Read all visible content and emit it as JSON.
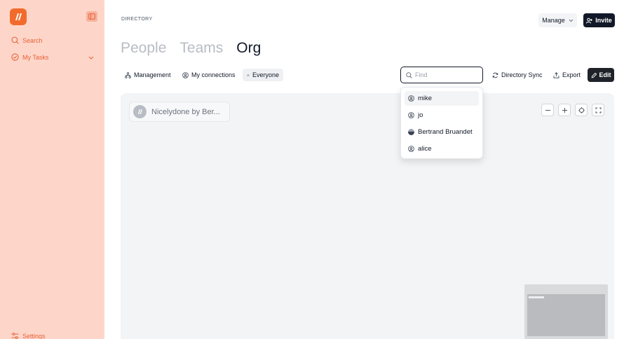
{
  "sidebar": {
    "items": [
      {
        "label": "Search",
        "icon": "search-icon"
      },
      {
        "label": "My Tasks",
        "icon": "check-circle-icon"
      }
    ],
    "settings_label": "Settings",
    "accent": "#f26b2c",
    "background": "#fdd6c9"
  },
  "header": {
    "breadcrumb": "DIRECTORY",
    "manage_label": "Manage",
    "invite_label": "Invite"
  },
  "tabs": [
    {
      "label": "People",
      "active": false
    },
    {
      "label": "Teams",
      "active": false
    },
    {
      "label": "Org",
      "active": true
    }
  ],
  "filters": [
    {
      "label": "Management",
      "icon": "hierarchy-icon"
    },
    {
      "label": "My connections",
      "icon": "person-circle-icon"
    },
    {
      "label": "Everyone",
      "icon": "group-icon",
      "selected": true
    }
  ],
  "find": {
    "placeholder": "Find",
    "value": ""
  },
  "actions": {
    "directory_sync_label": "Directory Sync",
    "export_label": "Export",
    "edit_label": "Edit"
  },
  "org_chart": {
    "root_node_name": "Nicelydone by Ber..."
  },
  "dropdown": {
    "items": [
      {
        "label": "mike",
        "highlighted": true
      },
      {
        "label": "jo"
      },
      {
        "label": "Bertrand Bruandet",
        "photo": true
      },
      {
        "label": "alice"
      }
    ]
  }
}
